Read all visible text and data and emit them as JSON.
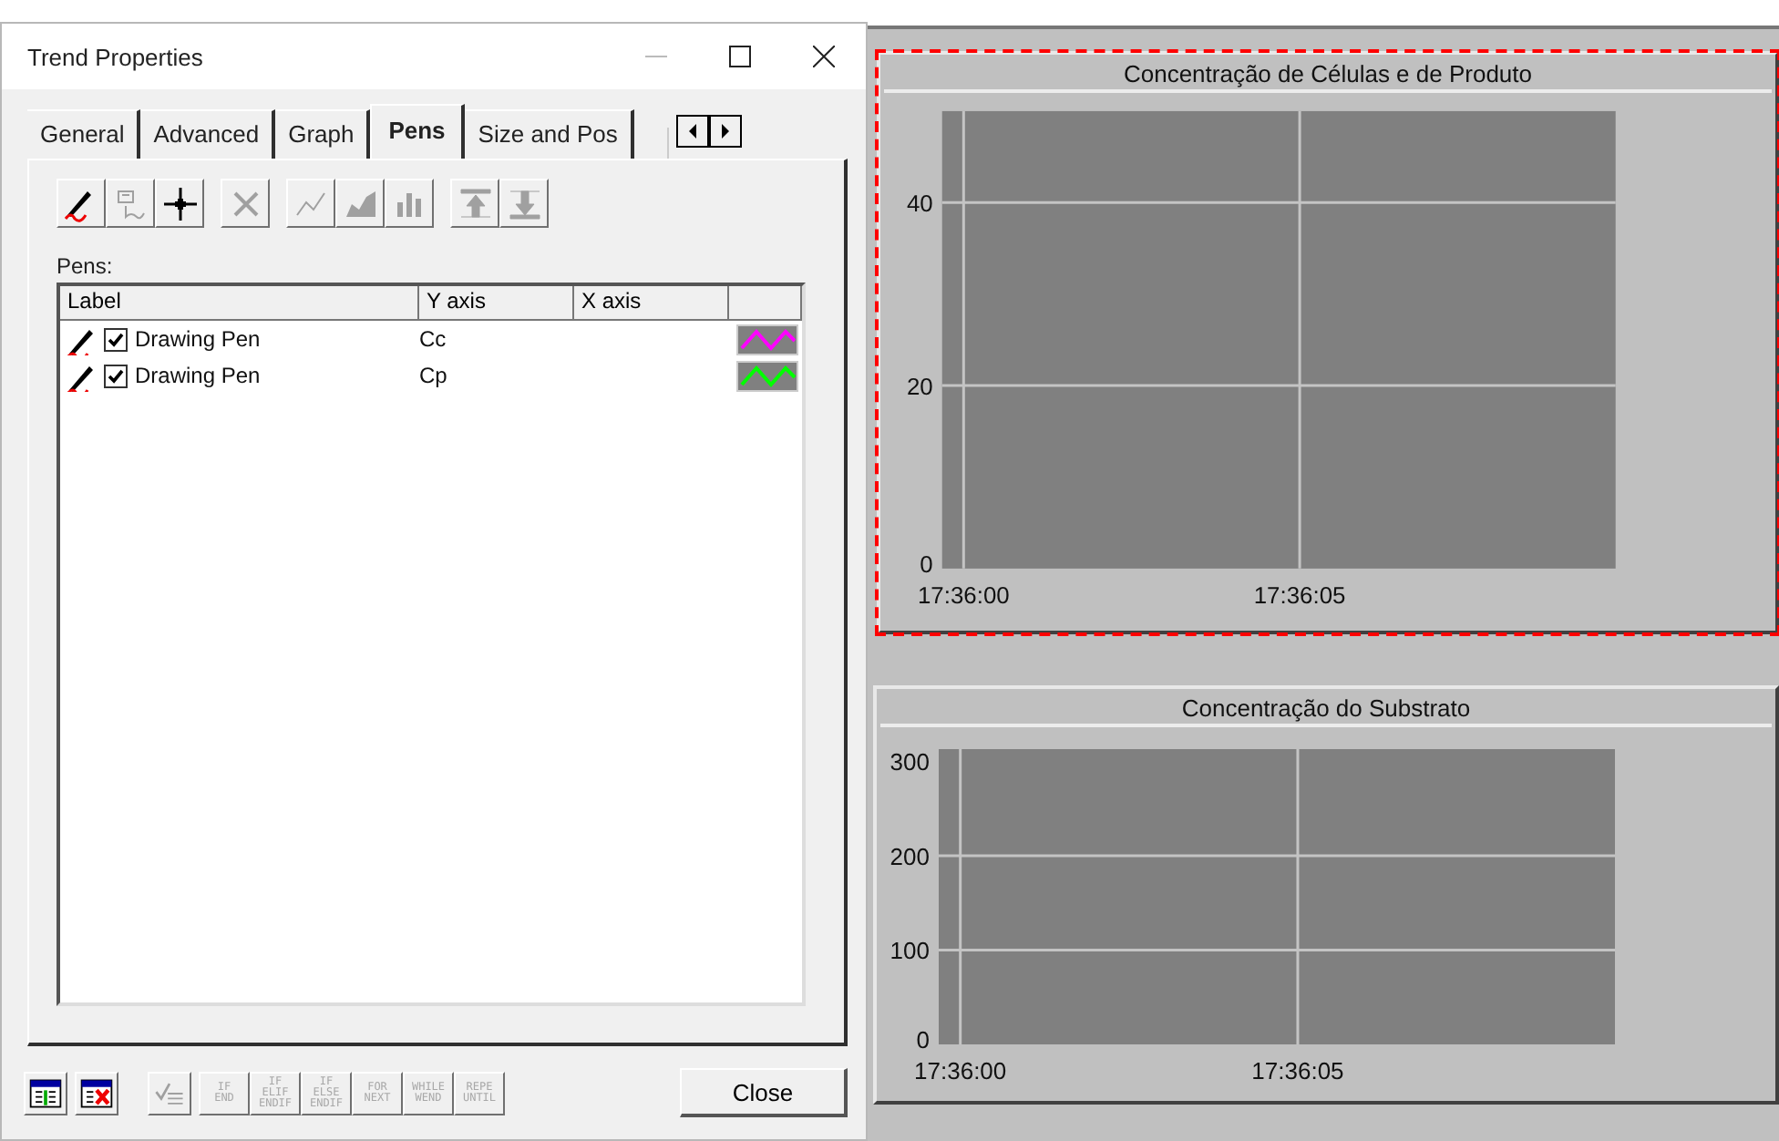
{
  "window": {
    "title": "Trend Properties"
  },
  "tabs": [
    {
      "label": "General",
      "selected": false
    },
    {
      "label": "Advanced",
      "selected": false
    },
    {
      "label": "Graph",
      "selected": false
    },
    {
      "label": "Pens",
      "selected": true
    },
    {
      "label": "Size and Pos",
      "selected": false
    }
  ],
  "toolbar_groups": [
    [
      {
        "kind": "pen",
        "disabled": false
      },
      {
        "kind": "pen-properties",
        "disabled": true
      },
      {
        "kind": "crosshair",
        "disabled": false
      }
    ],
    [
      {
        "kind": "delete",
        "disabled": true
      }
    ],
    [
      {
        "kind": "line",
        "disabled": true
      },
      {
        "kind": "area",
        "disabled": true
      },
      {
        "kind": "bar",
        "disabled": true
      }
    ],
    [
      {
        "kind": "move-up",
        "disabled": true
      },
      {
        "kind": "move-down",
        "disabled": true
      }
    ]
  ],
  "pens_label": "Pens:",
  "pens_table": {
    "columns": [
      "Label",
      "Y axis",
      "X axis"
    ],
    "rows": [
      {
        "label": "Drawing Pen",
        "checked": true,
        "y_axis": "Cc",
        "color": "#ff00ff"
      },
      {
        "label": "Drawing Pen",
        "checked": true,
        "y_axis": "Cp",
        "color": "#00ff00"
      }
    ]
  },
  "bottom_toolbar": [
    {
      "kind": "table-add",
      "disabled": false
    },
    {
      "kind": "table-delete",
      "disabled": false
    },
    {
      "kind": "checklist",
      "disabled": true
    },
    {
      "kind": "code",
      "disabled": true,
      "lines": [
        "IF",
        "END"
      ]
    },
    {
      "kind": "code",
      "disabled": true,
      "lines": [
        "IF",
        "ELIF",
        "ENDIF"
      ]
    },
    {
      "kind": "code",
      "disabled": true,
      "lines": [
        "IF",
        "ELSE",
        "ENDIF"
      ]
    },
    {
      "kind": "code",
      "disabled": true,
      "lines": [
        "FOR",
        "NEXT"
      ]
    },
    {
      "kind": "code",
      "disabled": true,
      "lines": [
        "WHILE",
        "WEND"
      ]
    },
    {
      "kind": "code",
      "disabled": true,
      "lines": [
        "REPE",
        "UNTIL"
      ]
    }
  ],
  "close_button": "Close",
  "trends": [
    {
      "selected": true,
      "chart_data": {
        "type": "line",
        "grid": true,
        "title": "Concentração de Células e de Produto",
        "categories": [
          "17:36:00",
          null,
          null,
          null,
          null,
          "17:36:05",
          null,
          null,
          null,
          null
        ],
        "ylim": [
          0,
          50
        ],
        "yticks": [
          0,
          20,
          40
        ]
      }
    },
    {
      "selected": false,
      "chart_data": {
        "type": "line",
        "grid": true,
        "title": "Concentração do Substrato",
        "categories": [
          "17:36:00",
          null,
          null,
          null,
          null,
          "17:36:05",
          null,
          null,
          null,
          null
        ],
        "ylim": [
          0,
          313
        ],
        "yticks": [
          0,
          100,
          200,
          300
        ]
      }
    }
  ]
}
